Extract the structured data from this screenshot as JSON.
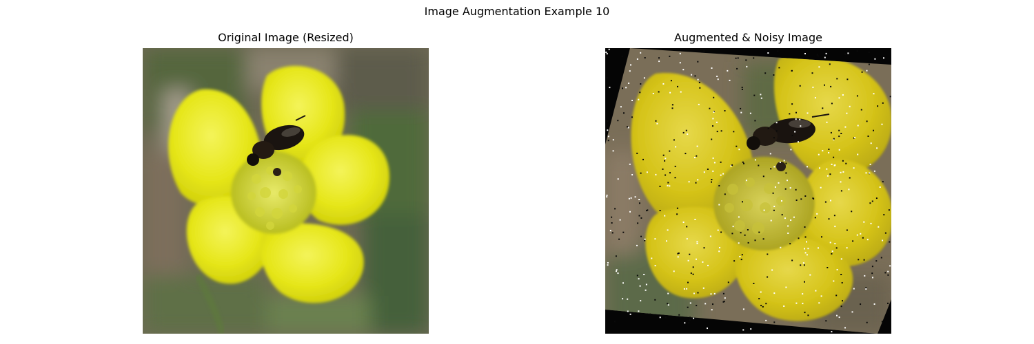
{
  "figure": {
    "suptitle": "Image Augmentation Example 10"
  },
  "panels": [
    {
      "title": "Original Image (Resized)"
    },
    {
      "title": "Augmented & Noisy Image"
    }
  ]
}
